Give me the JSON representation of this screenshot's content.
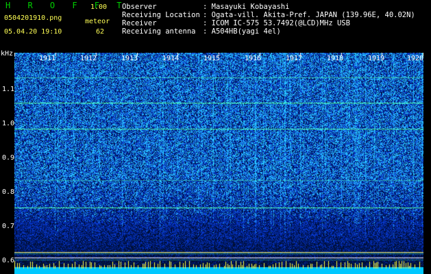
{
  "header": {
    "brand": "H R O F F T",
    "version": "1.00",
    "filename": "0504201910.png",
    "datetime": "05.04.20 19:10",
    "detection_label": "meteor",
    "detection_count": "62"
  },
  "info": [
    {
      "label": "Observer",
      "value": ": Masayuki Kobayashi"
    },
    {
      "label": "Receiving Location",
      "value": ": Ogata-vill. Akita-Pref. JAPAN (139.96E, 40.02N)"
    },
    {
      "label": "Receiver",
      "value": ": ICOM IC-575 53.7492(@LCD)MHz USB"
    },
    {
      "label": "Receiving antenna",
      "value": ": A504HB(yagi 4el)"
    }
  ],
  "spectrogram": {
    "unit": "kHz",
    "y_ticks": [
      "1.1",
      "1.0",
      "0.9",
      "0.8",
      "0.7",
      "0.6"
    ],
    "x_ticks": [
      "1911",
      "1912",
      "1913",
      "1914",
      "1915",
      "1916",
      "1917",
      "1918",
      "1919",
      "1920"
    ],
    "colors": {
      "background": "#00165a",
      "signal": "#2a8cff",
      "carrier": "#40ffa0",
      "timeline_bar": "#00c8ff",
      "timeline_spike": "#ffff40"
    }
  }
}
